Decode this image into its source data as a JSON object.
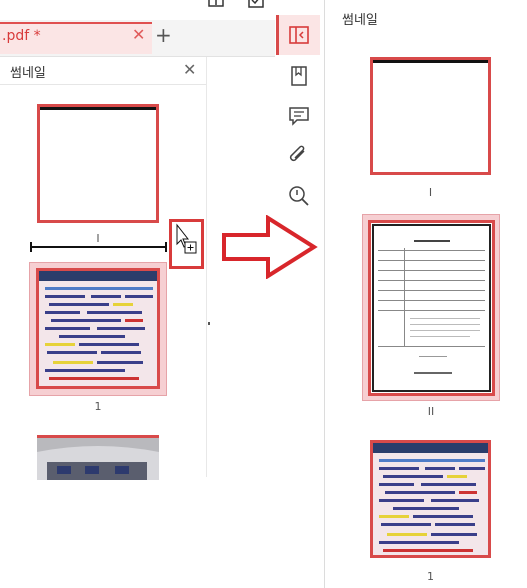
{
  "left_window": {
    "tab": {
      "name": ".pdf *"
    },
    "panel": {
      "title": "썸네일"
    },
    "thumbnails": [
      {
        "label": "I"
      },
      {
        "label": "1"
      }
    ]
  },
  "right_window": {
    "panel": {
      "title": "썸네일"
    },
    "thumbnails": [
      {
        "label": "I"
      },
      {
        "label": "II"
      },
      {
        "label": "1"
      }
    ]
  },
  "toolbar": {
    "icons": [
      "panel-toggle-icon",
      "bookmark-icon",
      "comment-icon",
      "attachment-icon",
      "search-icon"
    ]
  },
  "colors": {
    "accent": "#d84a4a",
    "tab_bg": "#fbe5e5",
    "poster_bg": "#f6cfd2"
  }
}
